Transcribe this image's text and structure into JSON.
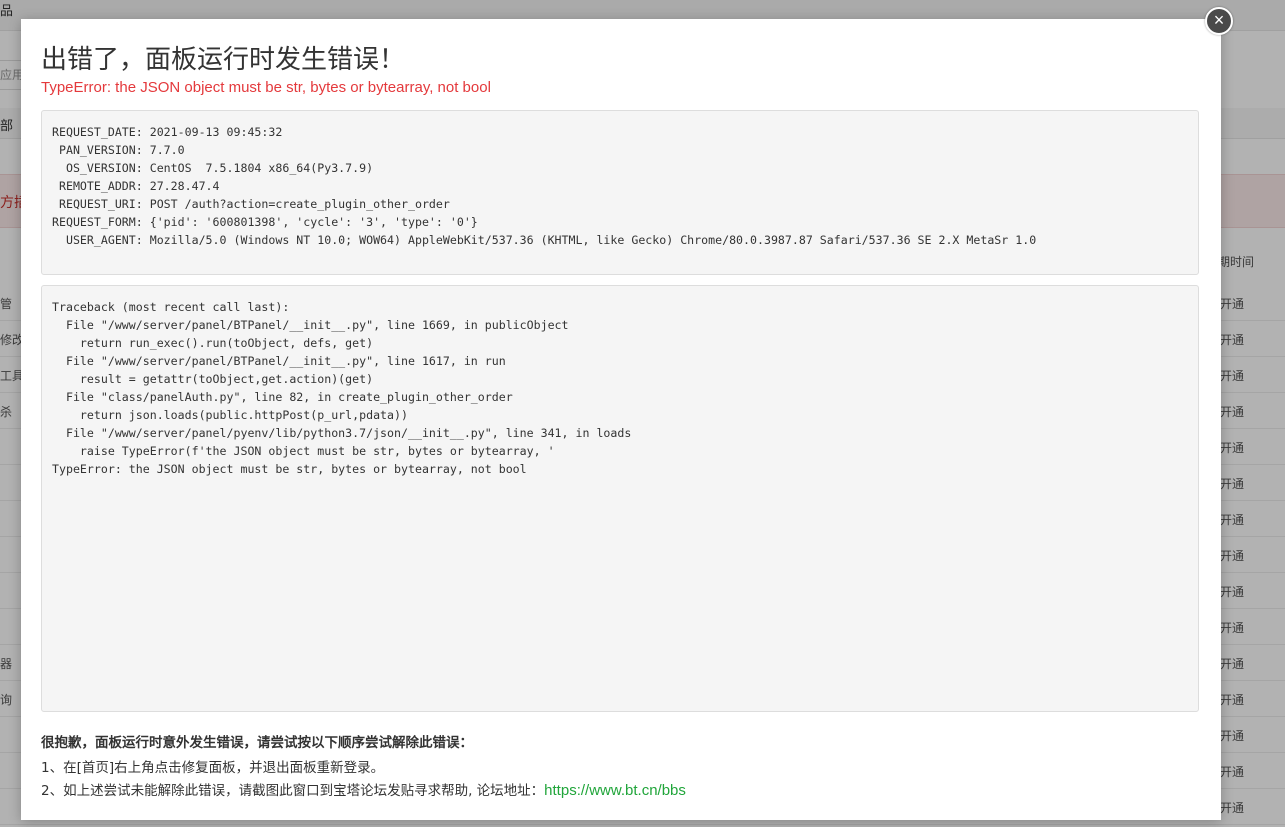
{
  "background": {
    "topbar_text": "品",
    "search_placeholder": "应用名",
    "tab_text": "部",
    "alert_text": "方插",
    "column_header": "期时间",
    "rows": [
      {
        "left": "管",
        "right": "开通"
      },
      {
        "left": "修改",
        "right": "开通"
      },
      {
        "left": "工具",
        "right": "开通"
      },
      {
        "left": "杀",
        "right": "开通"
      },
      {
        "left": "",
        "right": "开通"
      },
      {
        "left": "",
        "right": "开通"
      },
      {
        "left": "",
        "right": "开通"
      },
      {
        "left": "",
        "right": "开通"
      },
      {
        "left": "",
        "right": "开通"
      },
      {
        "left": "",
        "right": "开通"
      },
      {
        "left": "器",
        "right": "开通"
      },
      {
        "left": "询",
        "right": "开通"
      },
      {
        "left": "",
        "right": "开通"
      },
      {
        "left": "",
        "right": "开通"
      },
      {
        "left": "",
        "right": "开通"
      }
    ]
  },
  "dialog": {
    "close_glyph": "×",
    "title": "出错了，面板运行时发生错误！",
    "error_message": "TypeError: the JSON object must be str, bytes or bytearray, not bool",
    "request_info": "REQUEST_DATE: 2021-09-13 09:45:32\n PAN_VERSION: 7.7.0\n  OS_VERSION: CentOS  7.5.1804 x86_64(Py3.7.9)\n REMOTE_ADDR: 27.28.47.4\n REQUEST_URI: POST /auth?action=create_plugin_other_order\nREQUEST_FORM: {'pid': '600801398', 'cycle': '3', 'type': '0'}\n  USER_AGENT: Mozilla/5.0 (Windows NT 10.0; WOW64) AppleWebKit/537.36 (KHTML, like Gecko) Chrome/80.0.3987.87 Safari/537.36 SE 2.X MetaSr 1.0",
    "traceback": "Traceback (most recent call last):\n  File \"/www/server/panel/BTPanel/__init__.py\", line 1669, in publicObject\n    return run_exec().run(toObject, defs, get)\n  File \"/www/server/panel/BTPanel/__init__.py\", line 1617, in run\n    result = getattr(toObject,get.action)(get)\n  File \"class/panelAuth.py\", line 82, in create_plugin_other_order\n    return json.loads(public.httpPost(p_url,pdata))\n  File \"/www/server/panel/pyenv/lib/python3.7/json/__init__.py\", line 341, in loads\n    raise TypeError(f'the JSON object must be str, bytes or bytearray, '\nTypeError: the JSON object must be str, bytes or bytearray, not bool",
    "help_heading": "很抱歉，面板运行时意外发生错误，请尝试按以下顺序尝试解除此错误：",
    "help_step1": "1、在[首页]右上角点击修复面板，并退出面板重新登录。",
    "help_step2_prefix": "2、如上述尝试未能解除此错误，请截图此窗口到宝塔论坛发贴寻求帮助, 论坛地址：",
    "forum_url": "https://www.bt.cn/bbs"
  },
  "colors": {
    "error_red": "#e4393c",
    "link_green": "#20a53a",
    "overlay": "rgba(0,0,0,0.3)"
  }
}
